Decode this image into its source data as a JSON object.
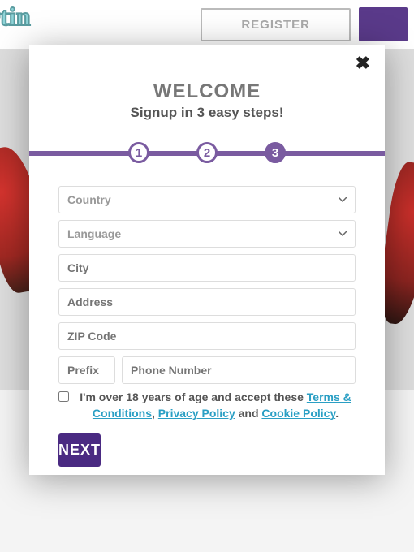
{
  "background": {
    "logo": "artin",
    "register_label": "REGISTER"
  },
  "modal": {
    "title": "WELCOME",
    "subtitle": "Signup in 3 easy steps!",
    "steps": [
      "1",
      "2",
      "3"
    ],
    "active_step": 3,
    "fields": {
      "country_placeholder": "Country",
      "language_placeholder": "Language",
      "city_placeholder": "City",
      "address_placeholder": "Address",
      "zip_placeholder": "ZIP Code",
      "prefix_placeholder": "Prefix",
      "phone_placeholder": "Phone Number"
    },
    "consent": {
      "prefix": "I'm over 18 years of age and accept these ",
      "terms": "Terms & Conditions",
      "sep1": ", ",
      "privacy": "Privacy Policy",
      "sep2": " and ",
      "cookie": "Cookie Policy",
      "suffix": "."
    },
    "next_label": "NEXT"
  }
}
